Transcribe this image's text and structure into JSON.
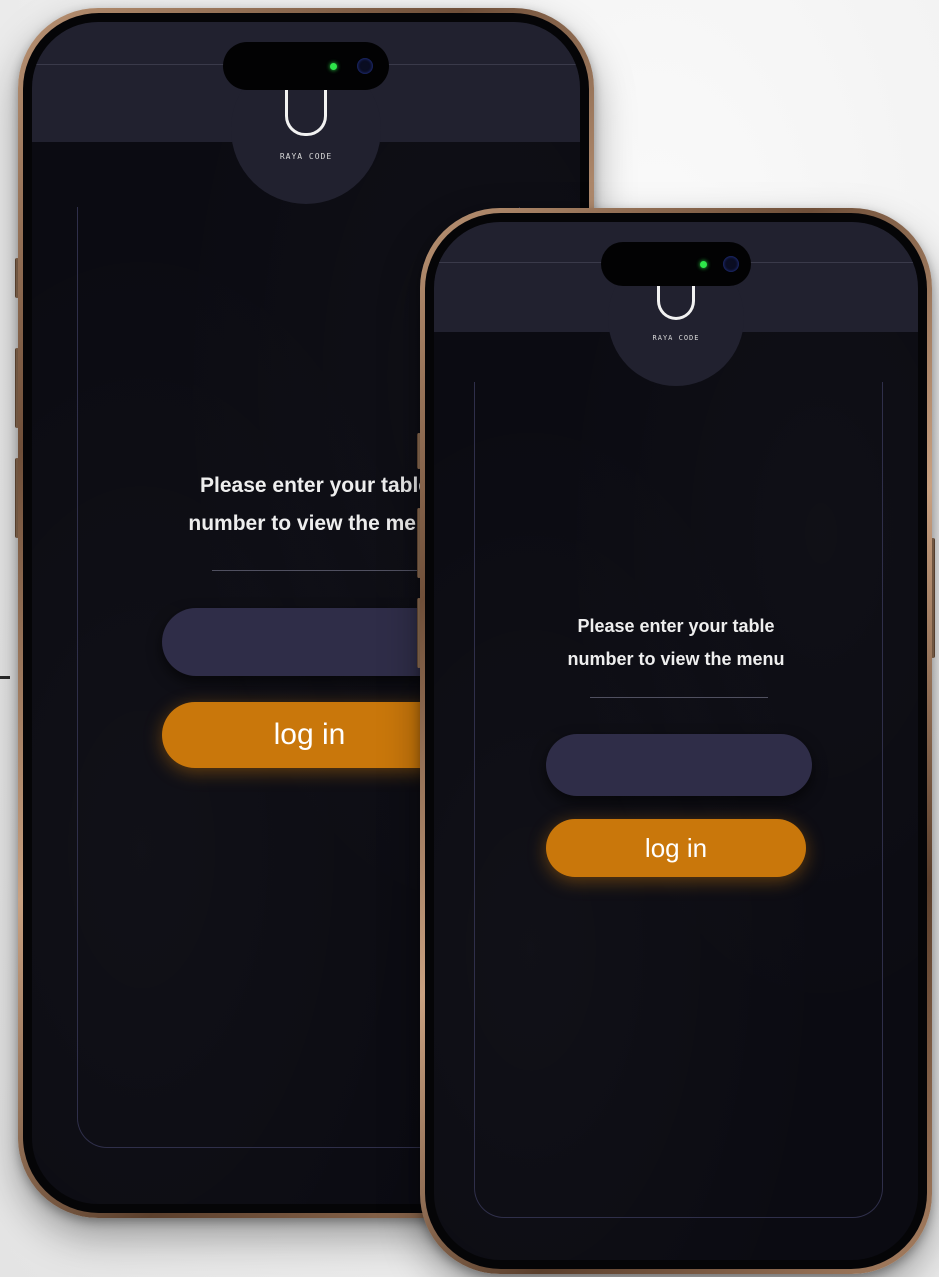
{
  "brand": {
    "logo_text": "RAYA CODE",
    "accent_color": "#c9770b",
    "header_color": "#21212f",
    "background_color": "#0b0b12"
  },
  "screens": [
    {
      "prompt_line1": "Please enter your table",
      "prompt_line2": "number to view the menu",
      "table_input": {
        "value": "",
        "placeholder": ""
      },
      "login_label": "log in"
    },
    {
      "prompt_line1": "Please enter your table",
      "prompt_line2": "number to view the menu",
      "table_input": {
        "value": "",
        "placeholder": ""
      },
      "login_label": "log in"
    }
  ]
}
